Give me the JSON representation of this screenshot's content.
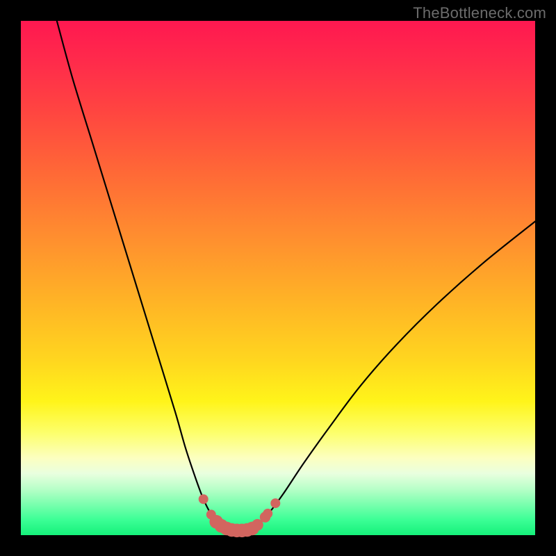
{
  "watermark": "TheBottleneck.com",
  "chart_data": {
    "type": "line",
    "title": "",
    "xlabel": "",
    "ylabel": "",
    "xlim": [
      0,
      100
    ],
    "ylim": [
      0,
      100
    ],
    "grid": false,
    "series": [
      {
        "name": "left-branch",
        "x": [
          7,
          10,
          14,
          18,
          22,
          26,
          30,
          32,
          34,
          35.5,
          37,
          38,
          39
        ],
        "values": [
          100,
          89,
          76,
          63,
          50,
          37,
          24,
          17,
          11,
          7,
          4,
          2.5,
          1.8
        ]
      },
      {
        "name": "floor",
        "x": [
          39,
          40,
          41,
          42,
          43,
          44,
          45,
          46
        ],
        "values": [
          1.8,
          1.3,
          1.0,
          0.9,
          0.9,
          1.0,
          1.3,
          2.0
        ]
      },
      {
        "name": "right-branch",
        "x": [
          46,
          48,
          51,
          55,
          60,
          66,
          73,
          81,
          90,
          100
        ],
        "values": [
          2.0,
          4,
          8,
          14,
          21,
          29,
          37,
          45,
          53,
          61
        ]
      }
    ],
    "markers": {
      "name": "bottom-dots",
      "color": "#d2655f",
      "points": [
        {
          "x": 35.5,
          "y": 7.0,
          "r": 1.0
        },
        {
          "x": 37.0,
          "y": 4.0,
          "r": 1.0
        },
        {
          "x": 38.0,
          "y": 2.6,
          "r": 1.4
        },
        {
          "x": 39.0,
          "y": 1.8,
          "r": 1.4
        },
        {
          "x": 40.0,
          "y": 1.3,
          "r": 1.4
        },
        {
          "x": 41.0,
          "y": 1.0,
          "r": 1.4
        },
        {
          "x": 42.0,
          "y": 0.9,
          "r": 1.4
        },
        {
          "x": 43.0,
          "y": 0.9,
          "r": 1.4
        },
        {
          "x": 44.0,
          "y": 1.0,
          "r": 1.4
        },
        {
          "x": 45.0,
          "y": 1.3,
          "r": 1.4
        },
        {
          "x": 46.0,
          "y": 2.0,
          "r": 1.2
        },
        {
          "x": 47.5,
          "y": 3.5,
          "r": 1.1
        },
        {
          "x": 48.0,
          "y": 4.2,
          "r": 1.0
        },
        {
          "x": 49.5,
          "y": 6.2,
          "r": 1.0
        }
      ]
    }
  }
}
